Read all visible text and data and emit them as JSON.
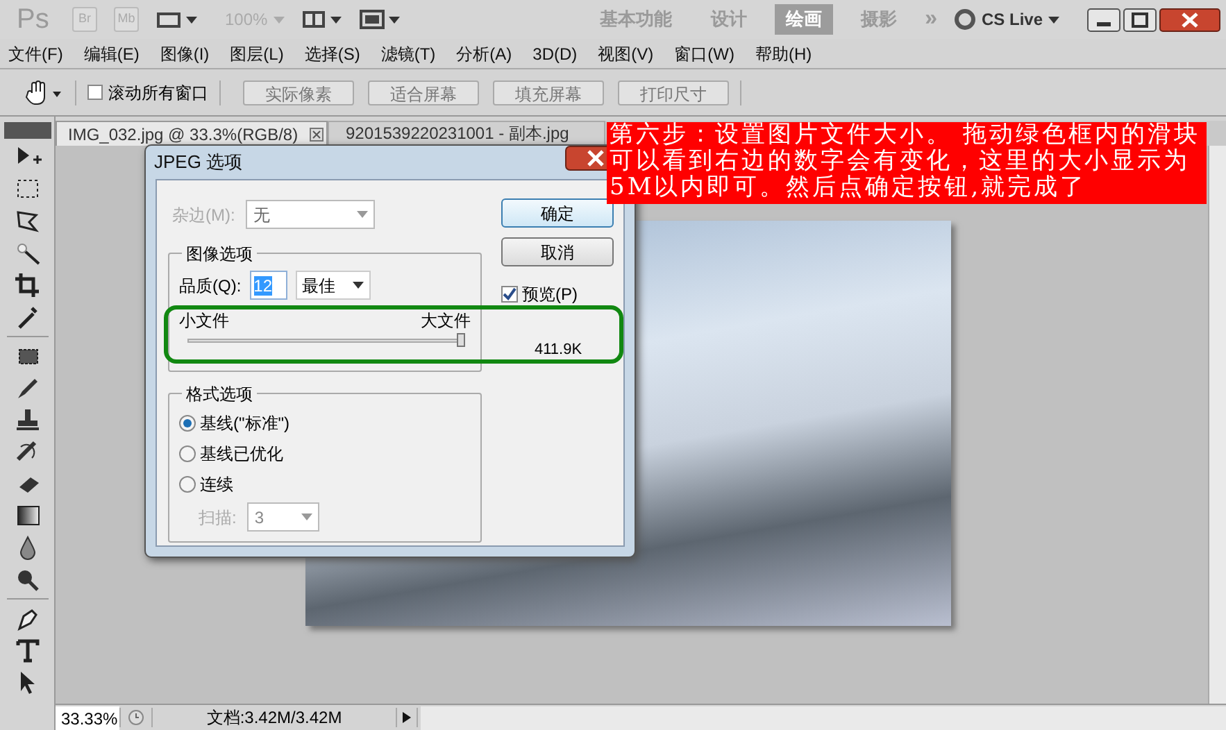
{
  "app_bar": {
    "logo": "Ps",
    "bridge_buttons": [
      "Br",
      "Mb"
    ],
    "zoom": "100%",
    "workspaces": [
      {
        "label": "基本功能",
        "selected": false
      },
      {
        "label": "设计",
        "selected": false
      },
      {
        "label": "绘画",
        "selected": true
      },
      {
        "label": "摄影",
        "selected": false
      }
    ],
    "more": "»",
    "cs_live": "CS Live"
  },
  "menu": [
    "文件(F)",
    "编辑(E)",
    "图像(I)",
    "图层(L)",
    "选择(S)",
    "滤镜(T)",
    "分析(A)",
    "3D(D)",
    "视图(V)",
    "窗口(W)",
    "帮助(H)"
  ],
  "options_bar": {
    "scroll_all": {
      "label": "滚动所有窗口",
      "checked": false
    },
    "buttons": [
      "实际像素",
      "适合屏幕",
      "填充屏幕",
      "打印尺寸"
    ]
  },
  "tabs": [
    {
      "label": "IMG_032.jpg @ 33.3%(RGB/8)",
      "selected": true
    },
    {
      "label": "9201539220231001 - 副本.jpg",
      "selected": false
    }
  ],
  "dialog": {
    "title": "JPEG 选项",
    "matte": {
      "label": "杂边(M):",
      "value": "无",
      "disabled": true
    },
    "image_options": {
      "title": "图像选项",
      "quality_label": "品质(Q):",
      "quality": "12",
      "quality_preset": "最佳",
      "small_label": "小文件",
      "large_label": "大文件",
      "slider": {
        "level": 1.0
      }
    },
    "format_options": {
      "title": "格式选项",
      "options": [
        {
          "label": "基线(\"标准\")",
          "selected": true
        },
        {
          "label": "基线已优化",
          "selected": false
        },
        {
          "label": "连续",
          "selected": false
        }
      ],
      "scans": {
        "label": "扫描:",
        "value": "3",
        "disabled": true
      }
    },
    "buttons": [
      "确定",
      "取消"
    ],
    "preview": {
      "label": "预览(P)",
      "checked": true
    },
    "size": "411.9K"
  },
  "annotation": "第六步：设置图片文件大小。 拖动绿色框内的滑块可以看到右边的数字会有变化，这里的大小显示为5M以内即可。然后点确定按钮,就完成了",
  "status_bar": {
    "zoom": "33.33%",
    "document": "文档:3.42M/3.42M"
  }
}
